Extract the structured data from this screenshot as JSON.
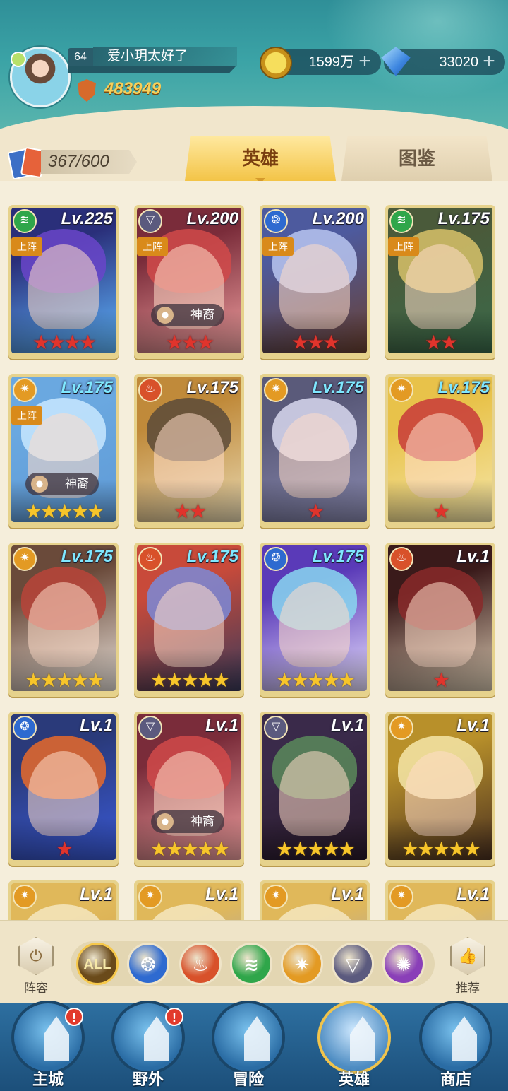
{
  "player": {
    "level": "64",
    "name": "爱小玥太好了",
    "power": "483949"
  },
  "resources": {
    "gold": "1599万",
    "gems": "33020",
    "plus": "+"
  },
  "roster": {
    "count": "367/600"
  },
  "tabs": [
    {
      "label": "英雄",
      "active": true
    },
    {
      "label": "图鉴",
      "active": false
    }
  ],
  "colors": {
    "fire": "#d8512a",
    "water": "#2e6ad0",
    "wind": "#2fa64a",
    "light": "#e39a23",
    "dark": "#5b5a7e",
    "void": "#8a3fb8"
  },
  "heroes": [
    {
      "element": "wind-icon",
      "level": "Lv.225",
      "level_color": "#ffffff",
      "deployed": "上阵",
      "tag": "",
      "stars": "★★★★",
      "star_type": "red",
      "art": [
        "#2a2f7a",
        "#6a45c9",
        "#5fb8ff"
      ]
    },
    {
      "element": "dark-icon",
      "level": "Lv.200",
      "level_color": "#ffffff",
      "deployed": "上阵",
      "tag": "神裔",
      "stars": "★★★",
      "star_type": "red",
      "art": [
        "#7a2c3a",
        "#d14a4a",
        "#f0a0a0"
      ]
    },
    {
      "element": "water-icon",
      "level": "Lv.200",
      "level_color": "#ffffff",
      "deployed": "上阵",
      "tag": "",
      "stars": "★★★",
      "star_type": "red",
      "art": [
        "#4d5a9e",
        "#b9c6f0",
        "#6a4030"
      ]
    },
    {
      "element": "wind-icon",
      "level": "Lv.175",
      "level_color": "#ffffff",
      "deployed": "上阵",
      "tag": "",
      "stars": "★★",
      "star_type": "red",
      "art": [
        "#4a5a3a",
        "#d8c26a",
        "#3a6a4a"
      ]
    },
    {
      "element": "light-icon",
      "level": "Lv.175",
      "level_color": "#7fe8ff",
      "deployed": "上阵",
      "tag": "神裔",
      "stars": "★★★★★",
      "star_type": "gold",
      "art": [
        "#6aa8e0",
        "#c8e8ff",
        "#5f9ad6"
      ]
    },
    {
      "element": "fire-icon",
      "level": "Lv.175",
      "level_color": "#ffffff",
      "deployed": "",
      "tag": "",
      "stars": "★★",
      "star_type": "red",
      "art": [
        "#c08a3a",
        "#5a4a3a",
        "#e8d8b0"
      ]
    },
    {
      "element": "light-icon",
      "level": "Lv.175",
      "level_color": "#7fe8ff",
      "deployed": "",
      "tag": "",
      "stars": "★",
      "star_type": "red",
      "art": [
        "#5a5a7a",
        "#d8d8ee",
        "#8a8ab0"
      ]
    },
    {
      "element": "light-icon",
      "level": "Lv.175",
      "level_color": "#7fe8ff",
      "deployed": "",
      "tag": "",
      "stars": "★",
      "star_type": "red",
      "art": [
        "#e8c24a",
        "#c83a3a",
        "#f5e6a8"
      ]
    },
    {
      "element": "light-icon",
      "level": "Lv.175",
      "level_color": "#7fe8ff",
      "deployed": "",
      "tag": "",
      "stars": "★★★★★",
      "star_type": "gold",
      "art": [
        "#6a4a3a",
        "#b8443a",
        "#e8e0d8"
      ]
    },
    {
      "element": "fire-icon",
      "level": "Lv.175",
      "level_color": "#7fe8ff",
      "deployed": "",
      "tag": "",
      "stars": "★★★★★",
      "star_type": "gold",
      "art": [
        "#c84a3a",
        "#7a8ad8",
        "#3a3a5a"
      ]
    },
    {
      "element": "water-icon",
      "level": "Lv.175",
      "level_color": "#7fe8ff",
      "deployed": "",
      "tag": "",
      "stars": "★★★★★",
      "star_type": "gold",
      "art": [
        "#5a3ab8",
        "#8ad8f0",
        "#e8e0ff"
      ]
    },
    {
      "element": "fire-icon",
      "level": "Lv.1",
      "level_color": "#ffffff",
      "deployed": "",
      "tag": "",
      "stars": "★",
      "star_type": "red",
      "art": [
        "#3a1a1a",
        "#8a2a2a",
        "#d8c8b0"
      ]
    },
    {
      "element": "water-icon",
      "level": "Lv.1",
      "level_color": "#ffffff",
      "deployed": "",
      "tag": "",
      "stars": "★",
      "star_type": "red",
      "art": [
        "#2a3a7a",
        "#e86a2a",
        "#3a5ad8"
      ]
    },
    {
      "element": "dark-icon",
      "level": "Lv.1",
      "level_color": "#ffffff",
      "deployed": "",
      "tag": "神裔",
      "stars": "★★★★★",
      "star_type": "gold",
      "art": [
        "#7a2c3a",
        "#d14a4a",
        "#f0a0a0"
      ]
    },
    {
      "element": "dark-icon",
      "level": "Lv.1",
      "level_color": "#ffffff",
      "deployed": "",
      "tag": "",
      "stars": "★★★★★",
      "star_type": "gold",
      "art": [
        "#3a2a4a",
        "#5a8a5a",
        "#2a1a2a"
      ]
    },
    {
      "element": "light-icon",
      "level": "Lv.1",
      "level_color": "#ffffff",
      "deployed": "",
      "tag": "",
      "stars": "★★★★★",
      "star_type": "gold",
      "art": [
        "#b8902a",
        "#f5e6a8",
        "#4a3020"
      ]
    },
    {
      "element": "light-icon",
      "level": "Lv.1",
      "level_color": "#ffffff",
      "deployed": "",
      "tag": "",
      "stars": "",
      "star_type": "gold",
      "art": [
        "#e0b85a",
        "#f5e6c0",
        "#c89a4a"
      ]
    },
    {
      "element": "light-icon",
      "level": "Lv.1",
      "level_color": "#ffffff",
      "deployed": "",
      "tag": "",
      "stars": "",
      "star_type": "gold",
      "art": [
        "#e0b85a",
        "#f5e6c0",
        "#8a9ad8"
      ]
    },
    {
      "element": "light-icon",
      "level": "Lv.1",
      "level_color": "#ffffff",
      "deployed": "",
      "tag": "",
      "stars": "",
      "star_type": "gold",
      "art": [
        "#e0b85a",
        "#f5e6c0",
        "#8a9ad8"
      ]
    },
    {
      "element": "light-icon",
      "level": "Lv.1",
      "level_color": "#ffffff",
      "deployed": "",
      "tag": "",
      "stars": "",
      "star_type": "gold",
      "art": [
        "#e0b85a",
        "#f5e6c0",
        "#8a9ad8"
      ]
    }
  ],
  "filters": {
    "lineup_label": "阵容",
    "recommend_label": "推荐",
    "items": [
      {
        "name": "all",
        "label": "ALL",
        "color": "#6a4a1a"
      },
      {
        "name": "water",
        "label": "",
        "color": "#2e6ad0"
      },
      {
        "name": "fire",
        "label": "",
        "color": "#d8512a"
      },
      {
        "name": "wind",
        "label": "",
        "color": "#2fa64a"
      },
      {
        "name": "light",
        "label": "",
        "color": "#e39a23"
      },
      {
        "name": "dark",
        "label": "",
        "color": "#5b5a7e"
      },
      {
        "name": "void",
        "label": "",
        "color": "#8a3fb8"
      }
    ]
  },
  "nav": [
    {
      "name": "nav-main-city",
      "label": "主城",
      "badge": "!",
      "active": false
    },
    {
      "name": "nav-wild",
      "label": "野外",
      "badge": "!",
      "active": false
    },
    {
      "name": "nav-adventure",
      "label": "冒险",
      "badge": "",
      "active": false
    },
    {
      "name": "nav-heroes",
      "label": "英雄",
      "badge": "",
      "active": true
    },
    {
      "name": "nav-shop",
      "label": "商店",
      "badge": "",
      "active": false
    }
  ]
}
